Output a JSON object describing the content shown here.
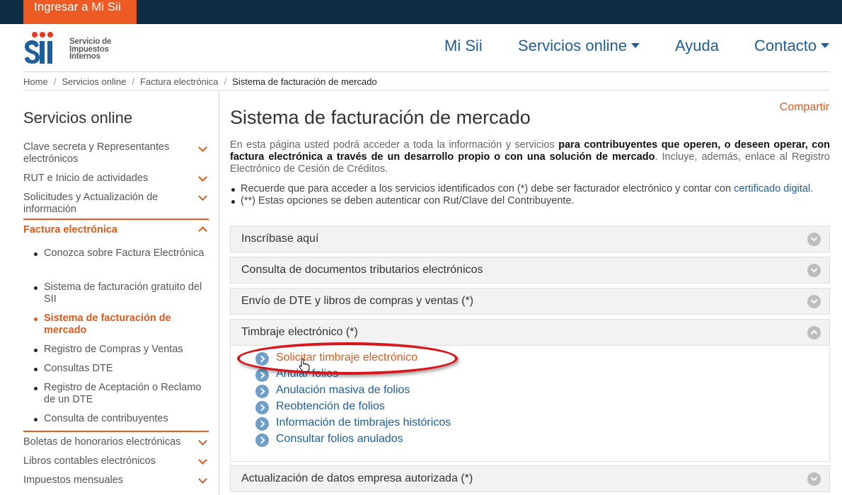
{
  "topbar": {
    "login_label": "Ingresar a Mi Sii"
  },
  "header": {
    "logo_lines": [
      "Servicio de",
      "Impuestos",
      "Internos"
    ],
    "nav": [
      {
        "label": "Mi Sii",
        "dropdown": false
      },
      {
        "label": "Servicios online",
        "dropdown": true
      },
      {
        "label": "Ayuda",
        "dropdown": false
      },
      {
        "label": "Contacto",
        "dropdown": true
      }
    ]
  },
  "breadcrumb": [
    "Home",
    "Servicios online",
    "Factura electrónica",
    "Sistema de facturación de mercado"
  ],
  "sidebar": {
    "title": "Servicios online",
    "items": [
      {
        "label": "Clave secreta y Representantes electrónicos"
      },
      {
        "label": "RUT e Inicio de actividades"
      },
      {
        "label": "Solicitudes y Actualización de información"
      },
      {
        "label": "Factura electrónica",
        "expanded": true
      },
      {
        "label": "Boletas de honorarios electrónicas"
      },
      {
        "label": "Libros contables electrónicos"
      },
      {
        "label": "Impuestos mensuales"
      }
    ],
    "subitems": [
      {
        "label": "Conozca sobre Factura Electrónica"
      },
      {
        "label": "Sistema de facturación gratuito del SII"
      },
      {
        "label": "Sistema de facturación de mercado",
        "current": true
      },
      {
        "label": "Registro de Compras y Ventas"
      },
      {
        "label": "Consultas DTE"
      },
      {
        "label": "Registro de Aceptación o Reclamo de un DTE"
      },
      {
        "label": "Consulta de contribuyentes"
      }
    ]
  },
  "main": {
    "title": "Sistema de facturación de mercado",
    "share_label": "Compartir",
    "intro": {
      "before": "En esta página usted podrá acceder a toda la información y servicios ",
      "bold": "para contribuyentes que operen, o deseen operar, con factura electrónica a través de un desarrollo propio o con una solución de mercado",
      "after": ". Incluye, además, enlace al Registro Electrónico de Cesión de Créditos."
    },
    "notes": [
      {
        "text": "Recuerde que para acceder a los servicios identificados con (*) debe ser facturador electrónico y contar con ",
        "link": "certificado digital",
        "tail": "."
      },
      {
        "text": "(**) Estas opciones se deben autenticar con Rut/Clave del Contribuyente."
      }
    ],
    "accordions": [
      {
        "label": "Inscríbase aquí",
        "open": false
      },
      {
        "label": "Consulta de documentos tributarios electrónicos",
        "open": false
      },
      {
        "label": "Envío de DTE y libros de compras y ventas (*)",
        "open": false
      },
      {
        "label": "Timbraje electrónico (*)",
        "open": true
      },
      {
        "label": "Actualización de datos empresa autorizada (*)",
        "open": false
      }
    ],
    "timbraje_links": [
      "Solicitar timbraje electrónico",
      "Anular folios",
      "Anulación masiva de folios",
      "Reobtención de folios",
      "Información de timbrajes históricos",
      "Consultar folios anulados"
    ]
  },
  "colors": {
    "topbar": "#0f2d45",
    "accent": "#ee5a24",
    "link": "#1e5e9a",
    "highlight_ellipse": "#d9161c"
  }
}
